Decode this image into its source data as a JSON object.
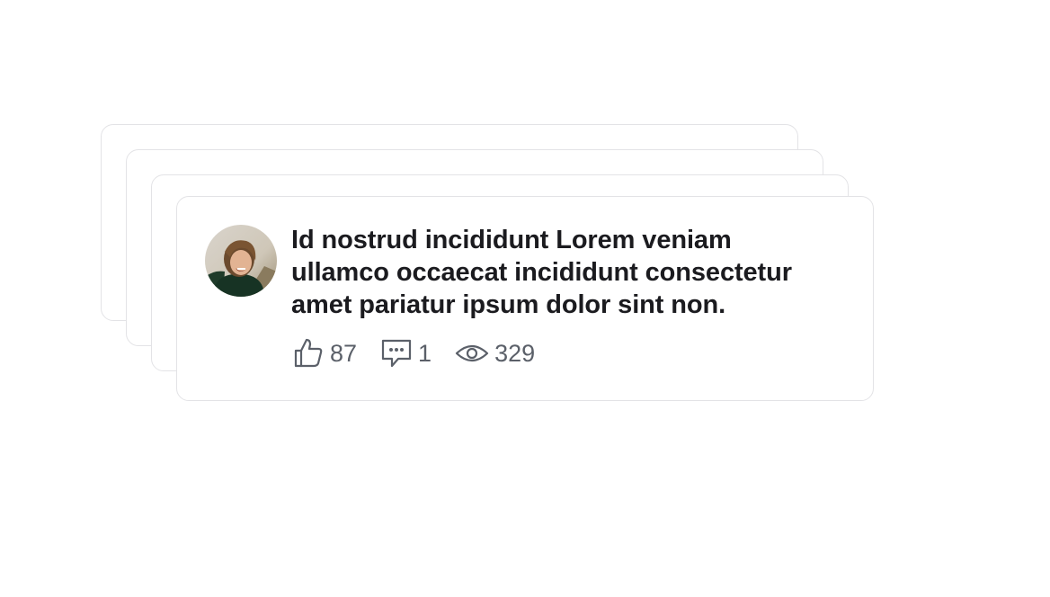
{
  "post": {
    "text": "Id nostrud incididunt Lorem veniam ullamco occaecat incididunt consectetur amet pariatur ipsum dolor sint non.",
    "avatar_icon": "user-photo",
    "stats": {
      "likes": "87",
      "comments": "1",
      "views": "329"
    }
  },
  "icons": {
    "likes": "thumbs-up-icon",
    "comments": "comment-icon",
    "views": "eye-icon"
  },
  "colors": {
    "text": "#1b1b1f",
    "muted": "#5b6069",
    "border": "#e3e3e6",
    "background": "#ffffff"
  }
}
